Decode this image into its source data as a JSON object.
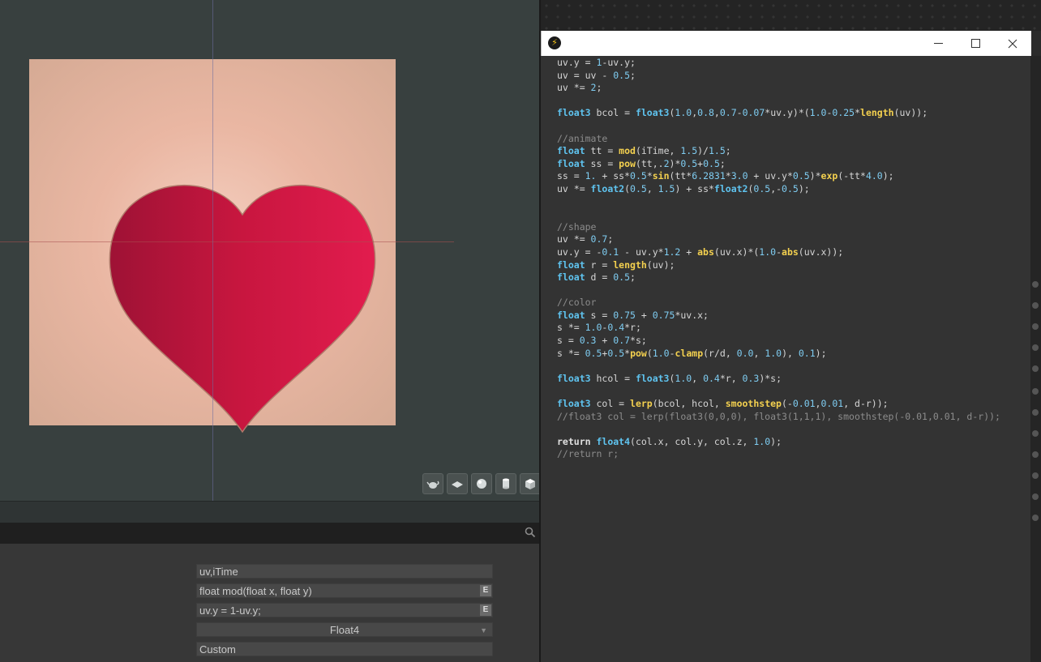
{
  "code_window": {
    "app_icon": "bolt-icon",
    "controls": {
      "minimize": "minimize-icon",
      "maximize": "maximize-icon",
      "close": "close-icon"
    },
    "lines": [
      [
        [
          "t",
          "uv.y = "
        ],
        [
          "n",
          "1"
        ],
        [
          "t",
          "-uv.y;"
        ]
      ],
      [
        [
          "t",
          "uv = uv - "
        ],
        [
          "n",
          "0.5"
        ],
        [
          "t",
          ";"
        ]
      ],
      [
        [
          "t",
          "uv *= "
        ],
        [
          "n",
          "2"
        ],
        [
          "t",
          ";"
        ]
      ],
      [],
      [
        [
          "k",
          "float3"
        ],
        [
          "t",
          " bcol = "
        ],
        [
          "k",
          "float3"
        ],
        [
          "t",
          "("
        ],
        [
          "n",
          "1.0"
        ],
        [
          "t",
          ","
        ],
        [
          "n",
          "0.8"
        ],
        [
          "t",
          ","
        ],
        [
          "n",
          "0.7"
        ],
        [
          "t",
          "-"
        ],
        [
          "n",
          "0.07"
        ],
        [
          "t",
          "*uv.y)*("
        ],
        [
          "n",
          "1.0"
        ],
        [
          "t",
          "-"
        ],
        [
          "n",
          "0.25"
        ],
        [
          "t",
          "*"
        ],
        [
          "f",
          "length"
        ],
        [
          "t",
          "(uv));"
        ]
      ],
      [],
      [
        [
          "c",
          "//animate"
        ]
      ],
      [
        [
          "k",
          "float"
        ],
        [
          "t",
          " tt = "
        ],
        [
          "f",
          "mod"
        ],
        [
          "t",
          "(iTime, "
        ],
        [
          "n",
          "1.5"
        ],
        [
          "t",
          ")/"
        ],
        [
          "n",
          "1.5"
        ],
        [
          "t",
          ";"
        ]
      ],
      [
        [
          "k",
          "float"
        ],
        [
          "t",
          " ss = "
        ],
        [
          "f",
          "pow"
        ],
        [
          "t",
          "(tt,."
        ],
        [
          "n",
          "2"
        ],
        [
          "t",
          ")*"
        ],
        [
          "n",
          "0.5"
        ],
        [
          "t",
          "+"
        ],
        [
          "n",
          "0.5"
        ],
        [
          "t",
          ";"
        ]
      ],
      [
        [
          "t",
          "ss = "
        ],
        [
          "n",
          "1."
        ],
        [
          "t",
          " + ss*"
        ],
        [
          "n",
          "0.5"
        ],
        [
          "t",
          "*"
        ],
        [
          "f",
          "sin"
        ],
        [
          "t",
          "(tt*"
        ],
        [
          "n",
          "6.2831"
        ],
        [
          "t",
          "*"
        ],
        [
          "n",
          "3.0"
        ],
        [
          "t",
          " + uv.y*"
        ],
        [
          "n",
          "0.5"
        ],
        [
          "t",
          ")*"
        ],
        [
          "f",
          "exp"
        ],
        [
          "t",
          "(-tt*"
        ],
        [
          "n",
          "4.0"
        ],
        [
          "t",
          ");"
        ]
      ],
      [
        [
          "t",
          "uv *= "
        ],
        [
          "k",
          "float2"
        ],
        [
          "t",
          "("
        ],
        [
          "n",
          "0.5"
        ],
        [
          "t",
          ", "
        ],
        [
          "n",
          "1.5"
        ],
        [
          "t",
          ") + ss*"
        ],
        [
          "k",
          "float2"
        ],
        [
          "t",
          "("
        ],
        [
          "n",
          "0.5"
        ],
        [
          "t",
          ",-"
        ],
        [
          "n",
          "0.5"
        ],
        [
          "t",
          ");"
        ]
      ],
      [],
      [],
      [
        [
          "c",
          "//shape"
        ]
      ],
      [
        [
          "t",
          "uv *= "
        ],
        [
          "n",
          "0.7"
        ],
        [
          "t",
          ";"
        ]
      ],
      [
        [
          "t",
          "uv.y = -"
        ],
        [
          "n",
          "0.1"
        ],
        [
          "t",
          " - uv.y*"
        ],
        [
          "n",
          "1.2"
        ],
        [
          "t",
          " + "
        ],
        [
          "f",
          "abs"
        ],
        [
          "t",
          "(uv.x)*("
        ],
        [
          "n",
          "1.0"
        ],
        [
          "t",
          "-"
        ],
        [
          "f",
          "abs"
        ],
        [
          "t",
          "(uv.x));"
        ]
      ],
      [
        [
          "k",
          "float"
        ],
        [
          "t",
          " r = "
        ],
        [
          "f",
          "length"
        ],
        [
          "t",
          "(uv);"
        ]
      ],
      [
        [
          "k",
          "float"
        ],
        [
          "t",
          " d = "
        ],
        [
          "n",
          "0.5"
        ],
        [
          "t",
          ";"
        ]
      ],
      [],
      [
        [
          "c",
          "//color"
        ]
      ],
      [
        [
          "k",
          "float"
        ],
        [
          "t",
          " s = "
        ],
        [
          "n",
          "0.75"
        ],
        [
          "t",
          " + "
        ],
        [
          "n",
          "0.75"
        ],
        [
          "t",
          "*uv.x;"
        ]
      ],
      [
        [
          "t",
          "s *= "
        ],
        [
          "n",
          "1.0"
        ],
        [
          "t",
          "-"
        ],
        [
          "n",
          "0.4"
        ],
        [
          "t",
          "*r;"
        ]
      ],
      [
        [
          "t",
          "s = "
        ],
        [
          "n",
          "0.3"
        ],
        [
          "t",
          " + "
        ],
        [
          "n",
          "0.7"
        ],
        [
          "t",
          "*s;"
        ]
      ],
      [
        [
          "t",
          "s *= "
        ],
        [
          "n",
          "0.5"
        ],
        [
          "t",
          "+"
        ],
        [
          "n",
          "0.5"
        ],
        [
          "t",
          "*"
        ],
        [
          "f",
          "pow"
        ],
        [
          "t",
          "("
        ],
        [
          "n",
          "1.0"
        ],
        [
          "t",
          "-"
        ],
        [
          "f",
          "clamp"
        ],
        [
          "t",
          "(r/d, "
        ],
        [
          "n",
          "0.0"
        ],
        [
          "t",
          ", "
        ],
        [
          "n",
          "1.0"
        ],
        [
          "t",
          "), "
        ],
        [
          "n",
          "0.1"
        ],
        [
          "t",
          ");"
        ]
      ],
      [],
      [
        [
          "k",
          "float3"
        ],
        [
          "t",
          " hcol = "
        ],
        [
          "k",
          "float3"
        ],
        [
          "t",
          "("
        ],
        [
          "n",
          "1.0"
        ],
        [
          "t",
          ", "
        ],
        [
          "n",
          "0.4"
        ],
        [
          "t",
          "*r, "
        ],
        [
          "n",
          "0.3"
        ],
        [
          "t",
          ")*s;"
        ]
      ],
      [],
      [
        [
          "k",
          "float3"
        ],
        [
          "t",
          " col = "
        ],
        [
          "f",
          "lerp"
        ],
        [
          "t",
          "(bcol, hcol, "
        ],
        [
          "f",
          "smoothstep"
        ],
        [
          "t",
          "(-"
        ],
        [
          "n",
          "0.01"
        ],
        [
          "t",
          ","
        ],
        [
          "n",
          "0.01"
        ],
        [
          "t",
          ", d-r));"
        ]
      ],
      [
        [
          "c",
          "//float3 col = lerp(float3(0,0,0), float3(1,1,1), smoothstep(-0.01,0.01, d-r));"
        ]
      ],
      [],
      [
        [
          "r",
          "return"
        ],
        [
          "t",
          " "
        ],
        [
          "k",
          "float4"
        ],
        [
          "t",
          "(col.x, col.y, col.z, "
        ],
        [
          "n",
          "1.0"
        ],
        [
          "t",
          ");"
        ]
      ],
      [
        [
          "c",
          "//return r;"
        ]
      ]
    ]
  },
  "properties": {
    "inputs": "uv,iTime",
    "functions": "float mod(float x, float y)",
    "body": "uv.y = 1-uv.y;",
    "edit_button": "E",
    "output_type": "Float4",
    "name": "Custom"
  },
  "viewport": {
    "tools": [
      "teapot-icon",
      "plane-icon",
      "sphere-icon",
      "cylinder-icon",
      "cube-icon"
    ],
    "heart_color": "#d81a4a"
  }
}
